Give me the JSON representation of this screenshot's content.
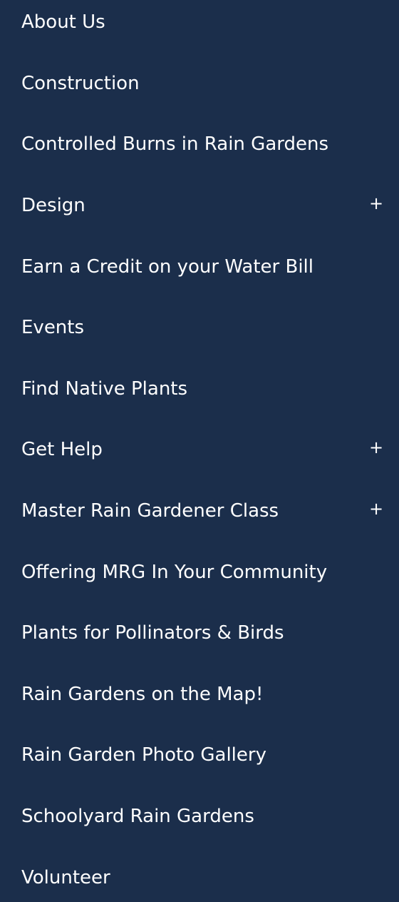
{
  "menu": {
    "items": [
      {
        "label": "About Us"
      },
      {
        "label": "Construction"
      },
      {
        "label": "Controlled Burns in Rain Gardens"
      },
      {
        "label": "Design",
        "expand": "+"
      },
      {
        "label": "Earn a Credit on your Water Bill"
      },
      {
        "label": "Events"
      },
      {
        "label": "Find Native Plants"
      },
      {
        "label": "Get Help",
        "expand": "+"
      },
      {
        "label": "Master Rain Gardener Class",
        "expand": "+"
      },
      {
        "label": "Offering MRG In Your Community"
      },
      {
        "label": "Plants for Pollinators & Birds"
      },
      {
        "label": "Rain Gardens on the Map!"
      },
      {
        "label": "Rain Garden Photo Gallery"
      },
      {
        "label": "Schoolyard Rain Gardens"
      },
      {
        "label": "Volunteer"
      }
    ]
  },
  "colors": {
    "background": "#1b2e4b",
    "text": "#ffffff"
  }
}
